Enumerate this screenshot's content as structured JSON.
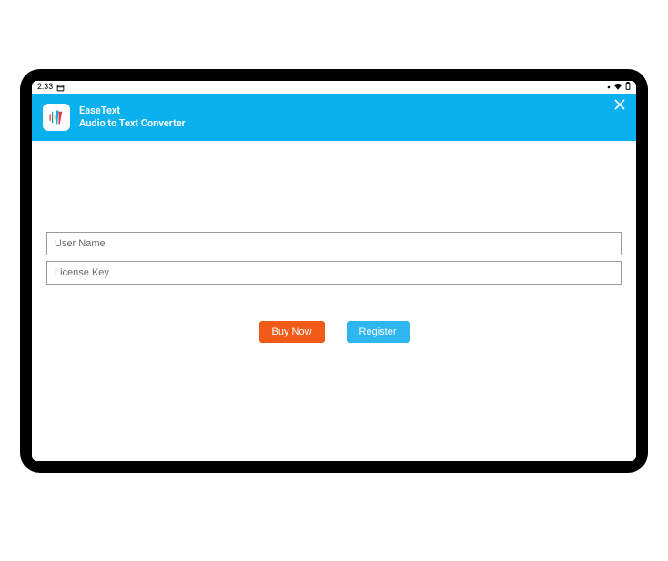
{
  "statusbar": {
    "time": "2:33"
  },
  "header": {
    "title": "EaseText",
    "subtitle": "Audio to Text Converter"
  },
  "form": {
    "username_placeholder": "User Name",
    "license_placeholder": "License Key"
  },
  "buttons": {
    "buy": "Buy Now",
    "register": "Register"
  }
}
